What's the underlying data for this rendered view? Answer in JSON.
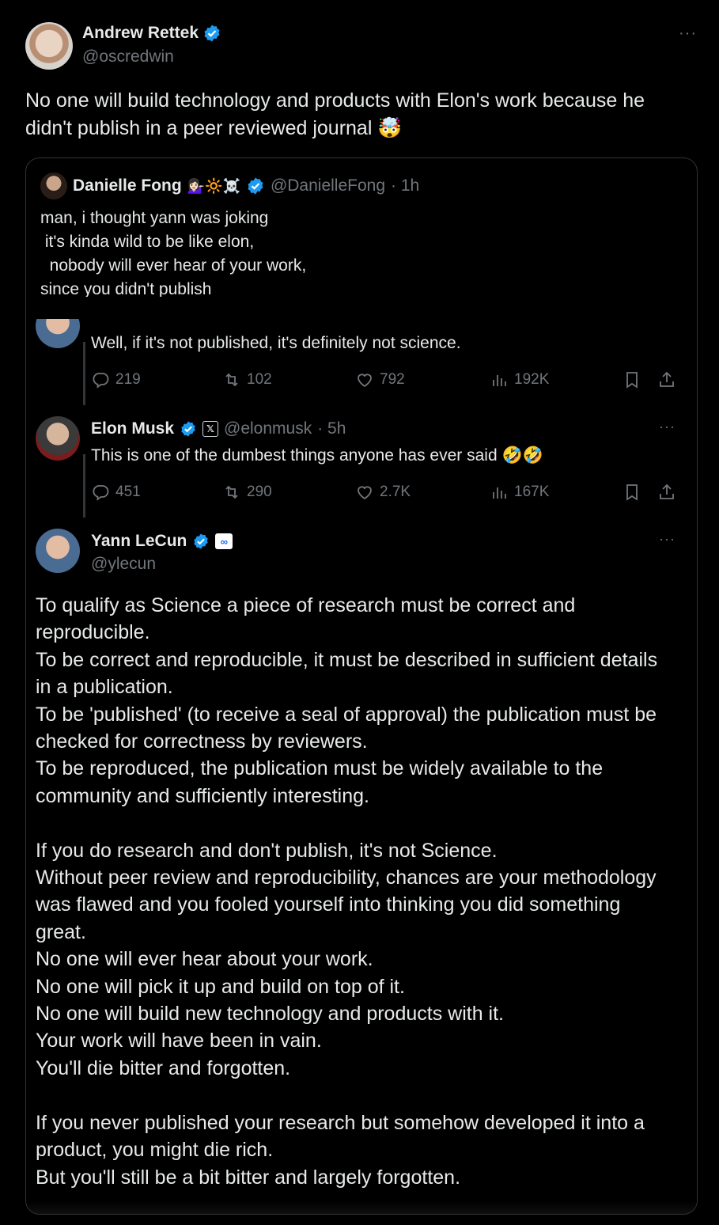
{
  "tweet": {
    "author_name": "Andrew Rettek",
    "author_handle": "@oscredwin",
    "text_line1": "No one will build technology and products with Elon's work because he",
    "text_line2": "didn't publish in a peer reviewed journal 🤯",
    "more": "···"
  },
  "quote": {
    "author_name": "Danielle Fong",
    "author_emojis": "💁🏻‍♀️🔆☠️",
    "author_handle": "@DanielleFong",
    "time": "· 1h",
    "text": "man, i thought yann was joking\n it's kinda wild to be like elon,\n  nobody will ever hear of your work,\nsince you didn't publish"
  },
  "replies": [
    {
      "body": "Well, if it's not published, it's definitely not science.",
      "replies": "219",
      "reposts": "102",
      "likes": "792",
      "views": "192K"
    },
    {
      "author_name": "Elon Musk",
      "author_handle": "@elonmusk",
      "time": "· 5h",
      "body": "This is one of the dumbest things anyone has ever said 🤣🤣",
      "replies": "451",
      "reposts": "290",
      "likes": "2.7K",
      "views": "167K"
    }
  ],
  "main": {
    "author_name": "Yann LeCun",
    "author_handle": "@ylecun",
    "paragraph1": "To qualify as Science a piece of research must be correct and\nreproducible.\nTo be correct and reproducible, it must be described in sufficient details\nin a publication.\nTo be 'published' (to receive a seal of approval) the publication must be\nchecked for correctness by reviewers.\nTo be reproduced, the publication must be widely available to the\ncommunity and sufficiently interesting.",
    "paragraph2": "If you do research and don't publish, it's not Science.\nWithout peer review and reproducibility, chances are your methodology\nwas flawed and you fooled yourself into thinking you did something\ngreat.\nNo one will ever hear about your work.\nNo one will pick it up and build on top of it.\nNo one will build new technology and products with it.\nYour work will have been in vain.\nYou'll die bitter and forgotten.",
    "paragraph3": "If you never published your research but somehow developed it into a\nproduct, you might die rich.\nBut you'll still be a bit bitter and largely forgotten."
  },
  "colors": {
    "background": "#000000",
    "text": "#e7e9ea",
    "secondary": "#71767b",
    "verified": "#1d9bf0",
    "border": "#2f3336"
  }
}
